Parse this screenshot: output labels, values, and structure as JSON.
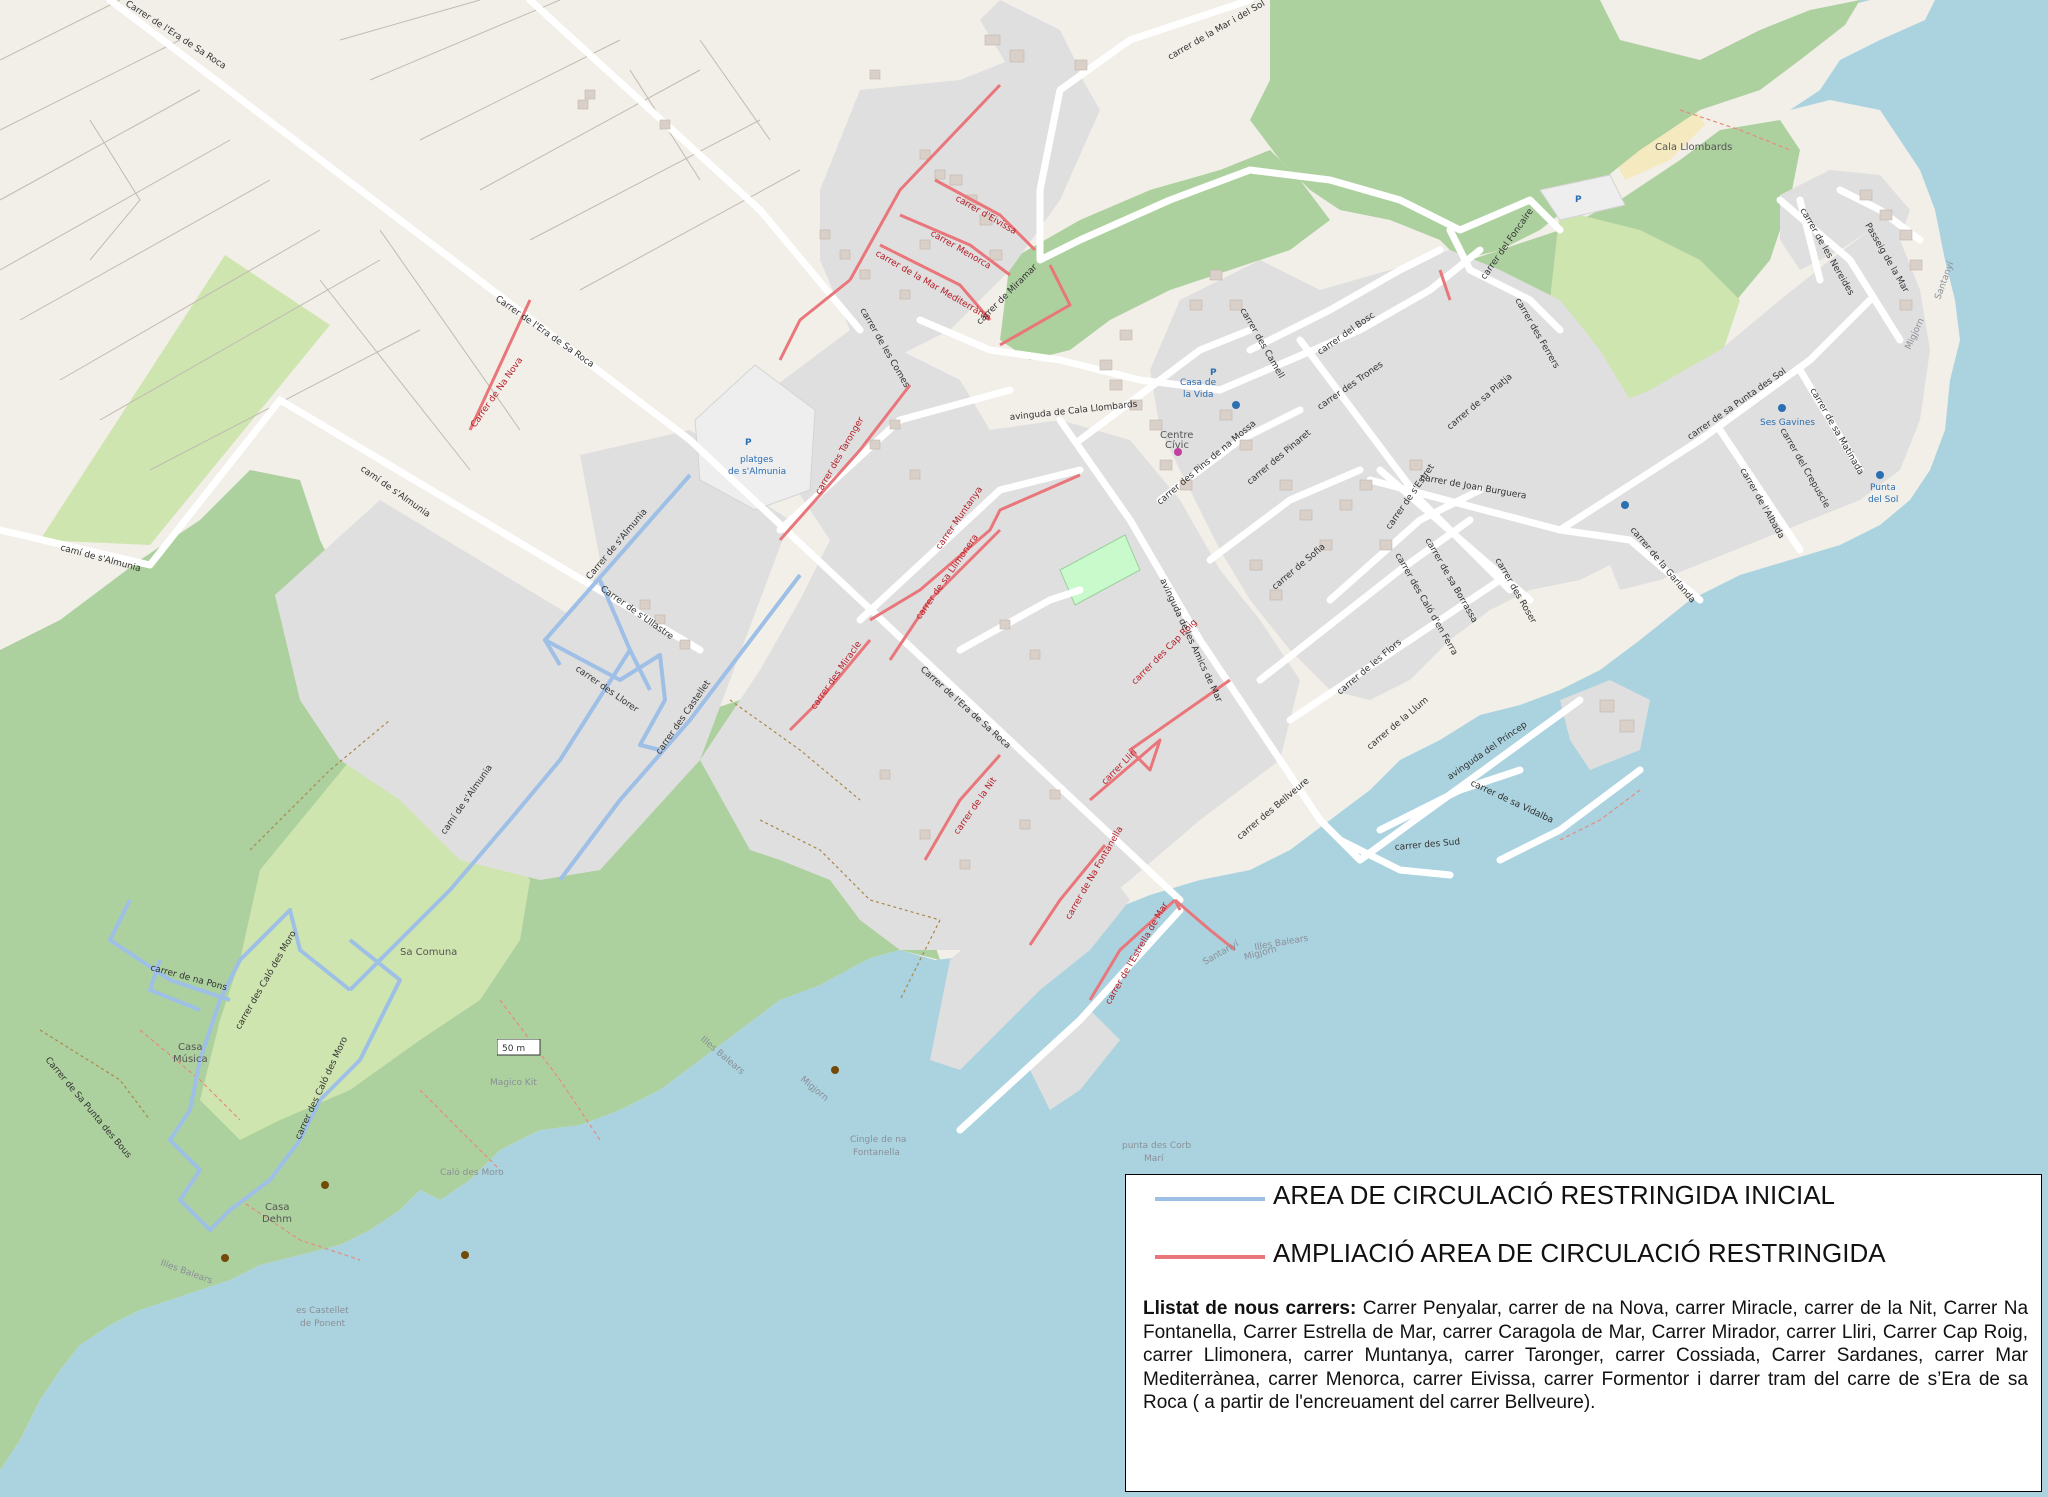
{
  "colors": {
    "sea": "#aad3df",
    "land": "#f2efe9",
    "residential": "#e0dfdf",
    "forest": "#add19e",
    "road": "#ffffff",
    "restricted_initial": "#9ebfe6",
    "restricted_extension": "#e8767a"
  },
  "legend": {
    "initial_label": "AREA DE CIRCULACIÓ RESTRINGIDA INICIAL",
    "extension_label": "AMPLIACIÓ AREA DE CIRCULACIÓ RESTRINGIDA",
    "list_title": "Llistat de nous carrers:",
    "list_text": "Carrer Penyalar, carrer de na Nova, carrer Miracle, carrer de la Nit, Carrer Na Fontanella, Carrer Estrella de Mar, carrer Caragola de Mar, Carrer Mirador, carrer Lliri, Carrer Cap Roig, carrer Llimonera, carrer Muntanya, carrer Taronger, carrer Cossiada, Carrer Sardanes, carrer Mar Mediterrànea, carrer Menorca, carrer Eivissa, carrer Formentor i darrer tram del carre de s’Era de sa Roca ( a partir de l'encreuament del carrer Bellveure)."
  },
  "scale_label": "50 m",
  "streets": {
    "era_sa_roca_1": "Carrer de l'Era de Sa Roca",
    "era_sa_roca_2": "Carrer de l'Era de Sa Roca",
    "era_sa_roca_3": "Carrer de l'Era de Sa Roca",
    "mar_i_sol": "carrer de la Mar i del Sol",
    "almunia_1": "camí de s'Almunia",
    "almunia_2": "camí de s'Almunia",
    "almunia_3": "Carrer de s'Almunia",
    "almunia_4": "camí de s'Almunia",
    "ullastre": "Carrer de s'Ullastre",
    "llorer": "carrer des Llorer",
    "castellet": "carrer des Castellet",
    "na_nova": "Carrer de Na Nova",
    "comes": "carrer de les Comes",
    "taronger": "carrer des Taronger",
    "eivissa": "carrer d'Eivissa",
    "menorca": "carrer Menorca",
    "mar_mediterrania": "carrer de la Mar Mediterrània",
    "miramar": "carrer de Miramar",
    "cala_llombards_av": "avinguda de Cala Llombards",
    "muntanya": "carrer Muntanya",
    "llimonera": "carrer de sa Llimonera",
    "miracle": "carrer des Miracle",
    "nit": "carrer de la Nit",
    "na_fontanella": "carrer de Na Fontanella",
    "estrella_mar": "carrer de l'Estrella de Mar",
    "cap_roig": "carrer des Cap Roig",
    "lliri": "carrer Lliri",
    "pins_na_mossa": "carrer des Pins de na Mossa",
    "pinaret": "carrer des Pinaret",
    "trones": "carrer des Trones",
    "bosc": "carrer del Bosc",
    "camell": "carrer des Camell",
    "foncaire": "carrer del Foncaire",
    "ferrers": "carrer des Ferrers",
    "sa_platja": "carrer de sa Platja",
    "joan_burguera": "carrer de Joan Burguera",
    "estret": "carrer de s'Estret",
    "sofia": "carrer de Sofia",
    "borrassa": "carrer de sa Borrassa",
    "roser": "carrer des Roser",
    "calo_den_ferra": "carrer des Caló d'en Ferra",
    "flors": "carrer de les Flors",
    "llum": "carrer de la Llum",
    "princep": "avinguda del Príncep",
    "vidalba": "carrer de sa Vidalba",
    "sud": "carrer des Sud",
    "bellveure": "carrer des Bellveure",
    "amics_mar": "avinguda de les Amics de Mar",
    "punta_sol": "carrer de sa Punta des Sol",
    "garlanda": "carrer de la Garlanda",
    "albada": "carrer de l'Albada",
    "crepuscle": "carrer del Crepuscle",
    "matinada": "carrer de sa Matinada",
    "nereides": "carrer de les Nereides",
    "passeig_mar": "Passeig de la Mar",
    "na_pons": "carrer de na Pons",
    "calo_moro_1": "carrer des Caló des Moro",
    "calo_moro_2": "carrer des Caló des Moro",
    "punta_bous": "Carrer de Sa Punta des Bous"
  },
  "places": {
    "platges_p": "P",
    "platges": "platges",
    "almunia_place": "de s'Almunia",
    "casa_vida_1": "Casa de",
    "casa_vida_2": "la Vida",
    "centre_civic_1": "Centre",
    "centre_civic_2": "Cívic",
    "sa_comuna": "Sa Comuna",
    "casa_musica_1": "Casa",
    "casa_musica_2": "Música",
    "casa_dehm_1": "Casa",
    "casa_dehm_2": "Dehm",
    "cingle_1": "Cingle de na",
    "cingle_2": "Fontanella",
    "punta_corb_1": "punta des Corb",
    "punta_corb_2": "Marí",
    "castellet_1": "es Castellet",
    "castellet_2": "de Ponent",
    "ses_gavines": "Ses Gavines",
    "punta_sol_1": "Punta",
    "punta_sol_2": "del Sol",
    "cala_llombards": "Cala Llombards",
    "parking_p": "P",
    "illes_balears_1": "Illes Balears",
    "illes_balears_2": "Illes Balears",
    "illes_balears_3": "Illes Balears",
    "migjorn_1": "Migjorn",
    "migjorn_2": "Migjorn",
    "migjorn_3": "Migjorn",
    "santanyi_1": "Santanyí",
    "santanyi_2": "Santanyí",
    "moro": "Caló des Moro",
    "marco_kit": "Magico Kit"
  }
}
